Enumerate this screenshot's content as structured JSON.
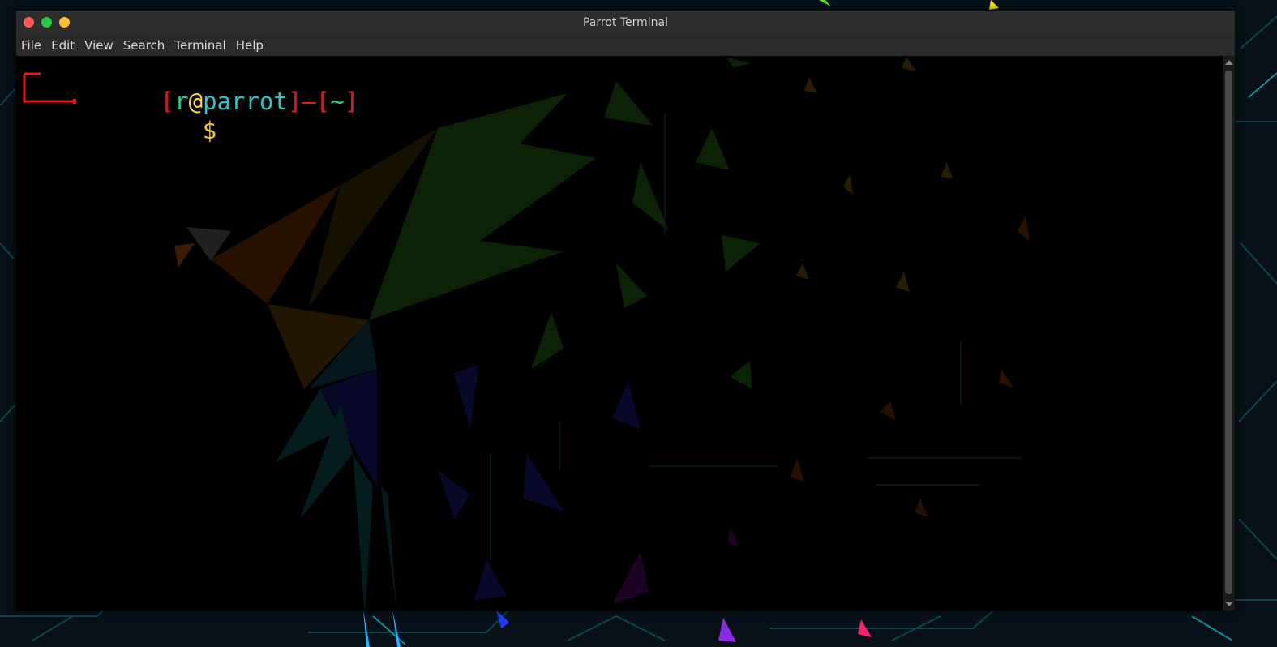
{
  "window": {
    "title": "Parrot Terminal",
    "buttons": [
      "close",
      "maximize",
      "minimize"
    ]
  },
  "menubar": {
    "items": [
      "File",
      "Edit",
      "View",
      "Search",
      "Terminal",
      "Help"
    ]
  },
  "prompt": {
    "open_bracket": "[",
    "user": "r",
    "at": "@",
    "host": "parrot",
    "close_bracket": "]",
    "dash": "—",
    "dir_open": "[",
    "dir": "~",
    "dir_close": "]",
    "symbol": "$"
  },
  "colors": {
    "bracket": "#e01b1b",
    "user": "#23d18b",
    "at": "#ffd33d",
    "host": "#2ec4c7",
    "dir": "#23d18b",
    "dollar": "#f3c13a",
    "titlebar": "#2d2d2d",
    "menubar": "#2b2b2b"
  }
}
